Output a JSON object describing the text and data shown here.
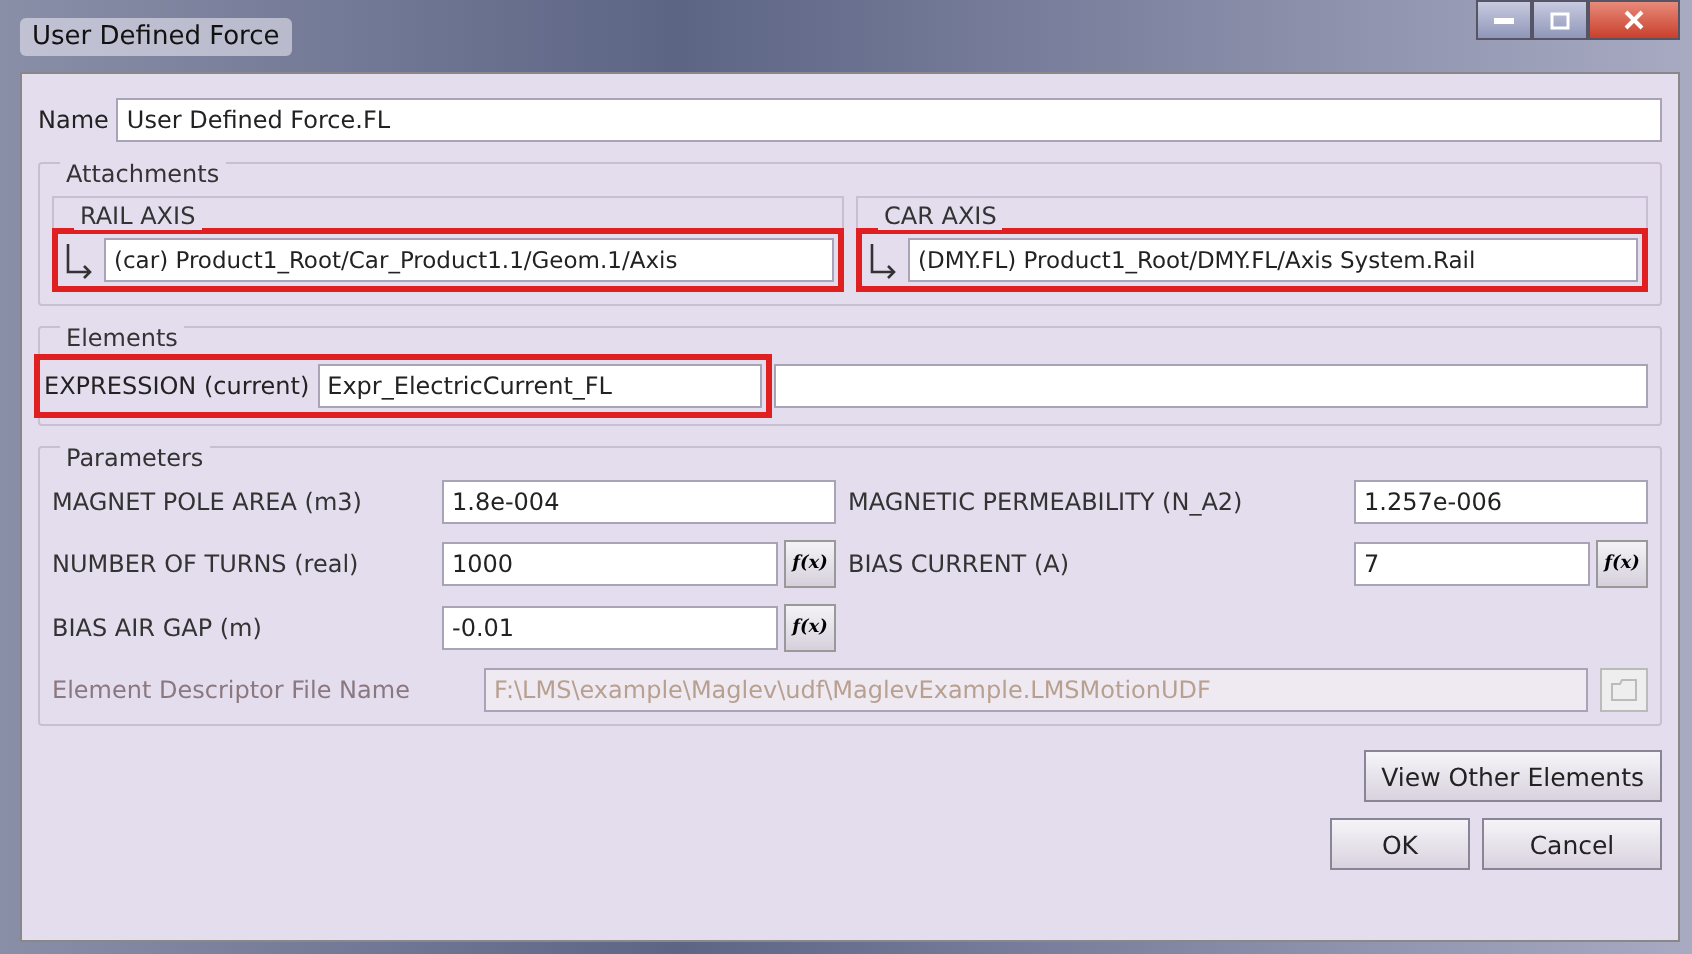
{
  "window": {
    "title": "User Defined Force"
  },
  "name": {
    "label": "Name",
    "value": "User Defined Force.FL"
  },
  "attachments": {
    "title": "Attachments",
    "axes": [
      {
        "title": "RAIL AXIS",
        "value": "(car) Product1_Root/Car_Product1.1/Geom.1/Axis",
        "highlighted": true
      },
      {
        "title": "CAR AXIS",
        "value": "(DMY.FL) Product1_Root/DMY.FL/Axis System.Rail",
        "highlighted": true
      }
    ]
  },
  "elements": {
    "title": "Elements",
    "label": "EXPRESSION (current)",
    "value": "Expr_ElectricCurrent_FL",
    "highlighted": true
  },
  "parameters": {
    "title": "Parameters",
    "rows": [
      [
        {
          "label": "MAGNET POLE AREA (m3)",
          "value": "1.8e-004"
        },
        {
          "label": "MAGNETIC PERMEABILITY (N_A2)",
          "value": "1.257e-006"
        }
      ],
      [
        {
          "label": "NUMBER OF TURNS (real)",
          "value": "1000",
          "formula": "f(x)"
        },
        {
          "label": "BIAS CURRENT (A)",
          "value": "7",
          "formula": "f(x)"
        }
      ],
      [
        {
          "label": "BIAS AIR GAP (m)",
          "value": "-0.01",
          "formula": "f(x)"
        }
      ]
    ],
    "descriptor": {
      "label": "Element Descriptor File Name",
      "value": "F:\\LMS\\example\\Maglev\\udf\\MaglevExample.LMSMotionUDF",
      "disabled": true
    }
  },
  "buttons": [
    {
      "label": "View Other Elements",
      "kind": "wide"
    },
    {
      "label": "OK",
      "kind": "small"
    },
    {
      "label": "Cancel",
      "kind": "small"
    }
  ]
}
